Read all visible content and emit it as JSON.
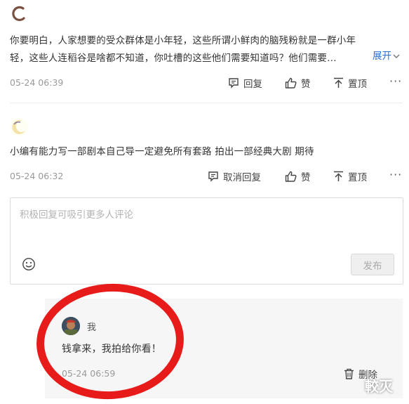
{
  "comment1": {
    "username": "",
    "text": "你要明白，人家想要的受众群体是小年轻，这些所谓小鲜肉的脑残粉就是一群小年轻，这些人连稻谷是啥都不知道，你吐槽的这些他们需要知道吗？他们需要…",
    "expand_label": "展开",
    "time": "05-24 06:39",
    "reply_label": "回复",
    "like_label": "赞",
    "pin_label": "置顶",
    "more_label": "···"
  },
  "comment2": {
    "text": "小编有能力写一部剧本自己导一定避免所有套路 拍出一部经典大剧 期待",
    "time": "05-24 06:32",
    "reply_label": "取消回复",
    "like_label": "赞",
    "pin_label": "置顶",
    "more_label": "···"
  },
  "reply_box": {
    "placeholder": "积极回复可吸引更多人评论",
    "publish_label": "发布"
  },
  "my_reply": {
    "username": "我",
    "text": "钱拿来，我拍给你看！",
    "time": "05-24 06:59",
    "delete_label": "删除"
  },
  "watermark": "較灭",
  "colors": {
    "accent_blue": "#2a6fd6",
    "highlight_red": "#e60a0a",
    "time_gray": "#9a9a9a"
  }
}
